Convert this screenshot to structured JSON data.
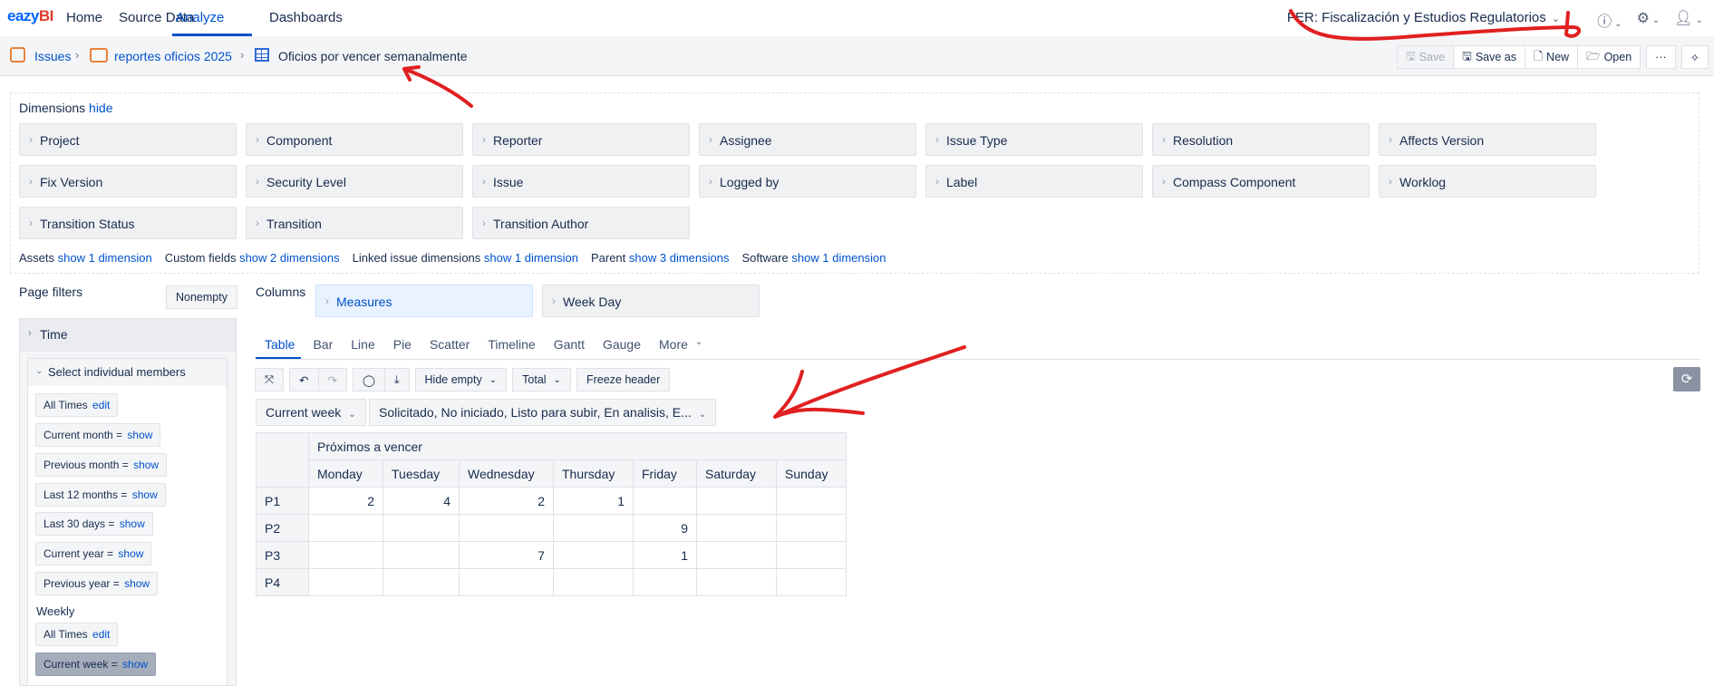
{
  "nav": {
    "logo": {
      "part1": "ea",
      "part2": "zy",
      "part3": "BI"
    },
    "items": [
      "Home",
      "Source Data",
      "Analyze",
      "Dashboards"
    ],
    "account": "FER: Fiscalización y Estudios Regulatorios"
  },
  "breadcrumb": {
    "issues": "Issues",
    "folder": "reportes oficios 2025",
    "report": "Oficios por vencer semanalmente"
  },
  "report_actions": {
    "save": "Save",
    "save_as": "Save as",
    "new": "New",
    "open": "Open",
    "more": "···"
  },
  "dimensions": {
    "title": "Dimensions",
    "hide": "hide",
    "cards": [
      "Project",
      "Component",
      "Reporter",
      "Assignee",
      "Issue Type",
      "Resolution",
      "Affects Version",
      "Fix Version",
      "Security Level",
      "Issue",
      "Logged by",
      "Label",
      "Compass Component",
      "Worklog",
      "Transition Status",
      "Transition",
      "Transition Author"
    ],
    "groups": [
      {
        "name": "Assets",
        "link": "show 1 dimension"
      },
      {
        "name": "Custom fields",
        "link": "show 2 dimensions"
      },
      {
        "name": "Linked issue dimensions",
        "link": "show 1 dimension"
      },
      {
        "name": "Parent",
        "link": "show 3 dimensions"
      },
      {
        "name": "Software",
        "link": "show 1 dimension"
      }
    ]
  },
  "page_filters": {
    "title": "Page filters",
    "nonempty": "Nonempty",
    "time": "Time",
    "select_members": "Select individual members",
    "members": [
      {
        "label": "All Times",
        "link": "edit"
      },
      {
        "label": "Current month =",
        "link": "show"
      },
      {
        "label": "Previous month =",
        "link": "show"
      },
      {
        "label": "Last 12 months =",
        "link": "show"
      },
      {
        "label": "Last 30 days =",
        "link": "show"
      },
      {
        "label": "Current year =",
        "link": "show"
      },
      {
        "label": "Previous year =",
        "link": "show"
      }
    ],
    "weekly_title": "Weekly",
    "weekly_members": [
      {
        "label": "All Times",
        "link": "edit"
      },
      {
        "label": "Current week =",
        "link": "show"
      }
    ]
  },
  "columns": {
    "title": "Columns",
    "cards": [
      "Measures",
      "Week Day"
    ]
  },
  "tabs": [
    "Table",
    "Bar",
    "Line",
    "Pie",
    "Scatter",
    "Timeline",
    "Gantt",
    "Gauge",
    "More"
  ],
  "toolbar": {
    "hide_empty": "Hide empty",
    "total": "Total",
    "freeze": "Freeze header"
  },
  "selectors": {
    "week": "Current week",
    "status": "Solicitado, No iniciado, Listo para subir, En analisis, E..."
  },
  "table": {
    "group_header": "Próximos a vencer",
    "days": [
      "Monday",
      "Tuesday",
      "Wednesday",
      "Thursday",
      "Friday",
      "Saturday",
      "Sunday"
    ],
    "rows": [
      {
        "label": "P1",
        "values": [
          "2",
          "4",
          "2",
          "1",
          "",
          "",
          ""
        ]
      },
      {
        "label": "P2",
        "values": [
          "",
          "",
          "",
          "",
          "9",
          "",
          ""
        ]
      },
      {
        "label": "P3",
        "values": [
          "",
          "",
          "7",
          "",
          "1",
          "",
          ""
        ]
      },
      {
        "label": "P4",
        "values": [
          "",
          "",
          "",
          "",
          "",
          "",
          ""
        ]
      }
    ]
  },
  "colors": {
    "accent": "#0052cc",
    "annotation": "#e02020"
  }
}
